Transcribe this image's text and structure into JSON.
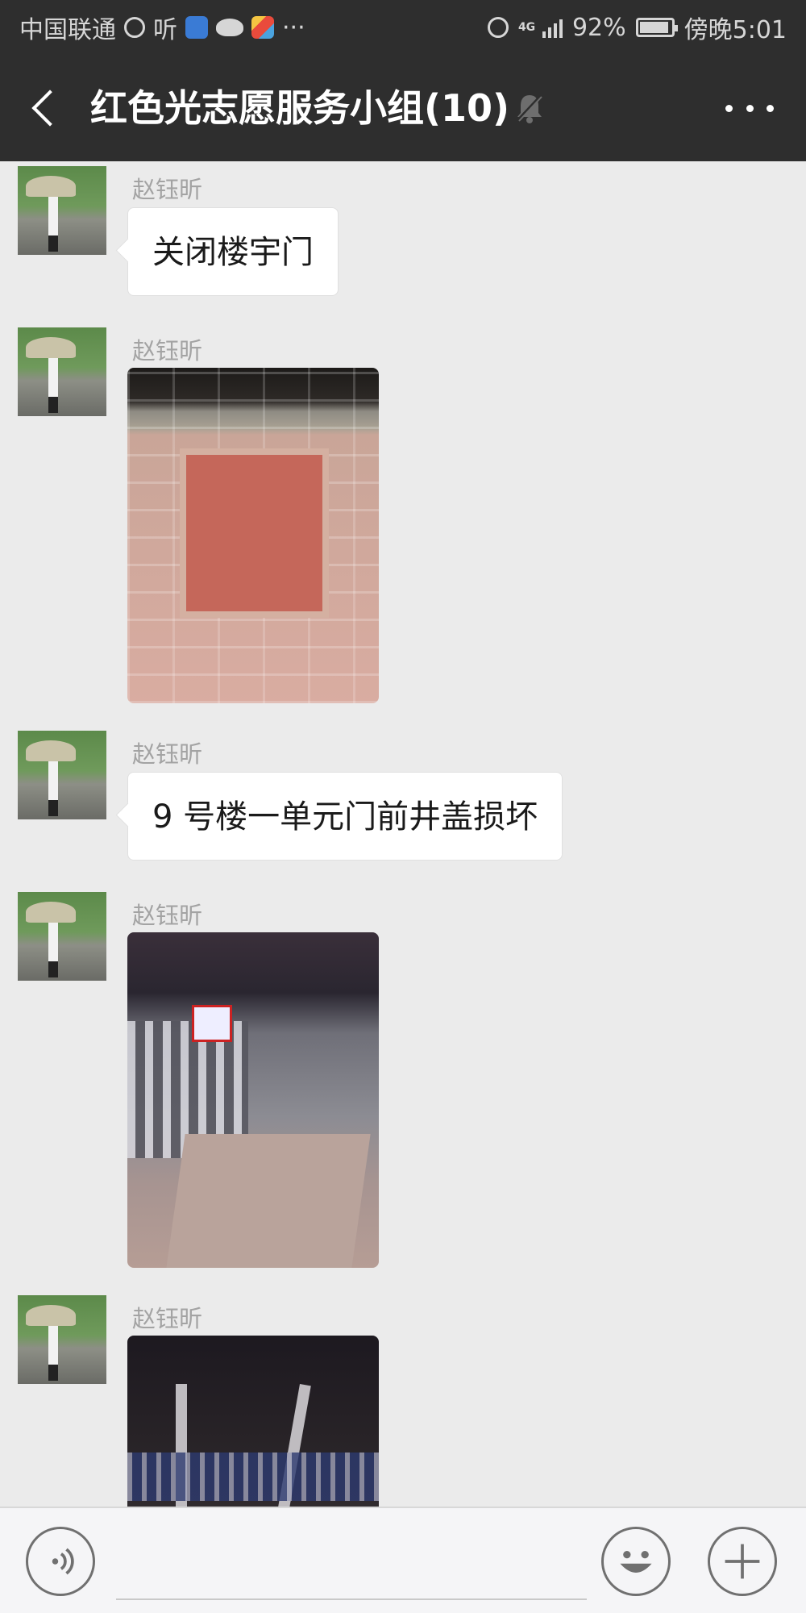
{
  "status_bar": {
    "carrier": "中国联通",
    "listen_label": "听",
    "network_type": "4G",
    "battery": "92%",
    "time": "傍晚5:01",
    "more_dots": "···"
  },
  "header": {
    "title": "红色光志愿服务小组(10)",
    "icons": [
      "back-arrow-icon",
      "mute-bell-icon",
      "more-icon"
    ]
  },
  "messages": [
    {
      "sender": "赵钰昕",
      "type": "text",
      "text": "关闭楼宇门"
    },
    {
      "sender": "赵钰昕",
      "type": "image",
      "image": "brick-wall-photo"
    },
    {
      "sender": "赵钰昕",
      "type": "text",
      "text": "9 号楼一单元门前井盖损坏"
    },
    {
      "sender": "赵钰昕",
      "type": "image",
      "image": "night-path-photo"
    },
    {
      "sender": "赵钰昕",
      "type": "image",
      "image": "night-trees-photo"
    }
  ],
  "input_bar": {
    "message_value": "",
    "icons": [
      "voice-icon",
      "emoji-icon",
      "plus-icon"
    ]
  },
  "colors": {
    "header_bg": "#2e2e2e",
    "chat_bg": "#ebebeb",
    "bubble_bg": "#ffffff",
    "sender_name": "#a3a3a3"
  }
}
